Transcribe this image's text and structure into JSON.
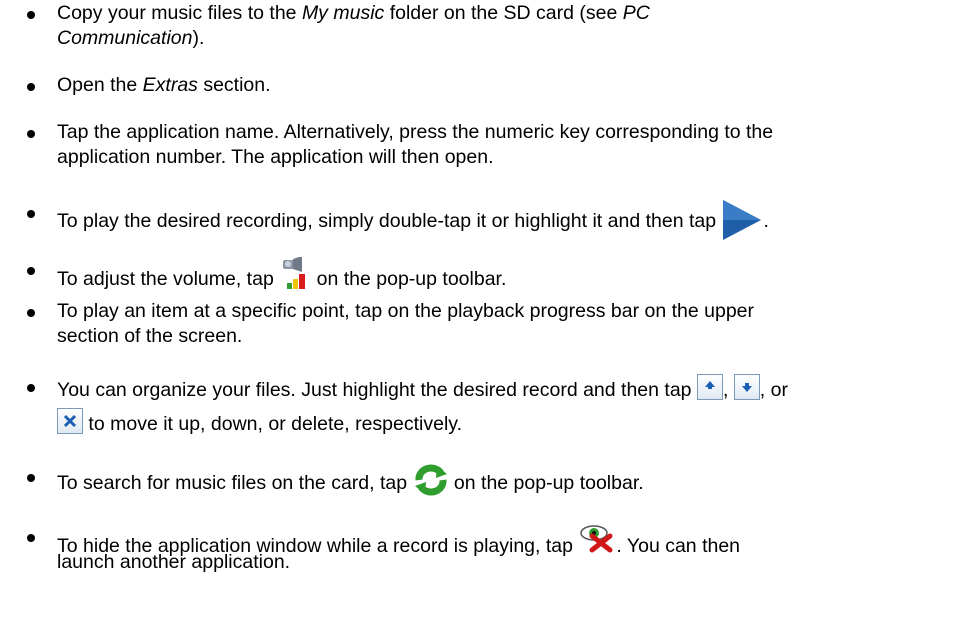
{
  "items": [
    {
      "p1": "Copy your music files to the ",
      "em1": "My music",
      "p2": " folder on the SD card (see ",
      "em2": "PC",
      "line2_em": "Communication",
      "line2_end": ")."
    },
    {
      "p1": "Open the ",
      "em1": "Extras",
      "p2": " section."
    },
    {
      "line1": "Tap the application name. Alternatively, press the numeric key corresponding to the",
      "line2": "application number. The application will then open."
    },
    {
      "p1": "To play the desired recording, simply double-tap it or highlight it and then tap",
      "icon": "play-icon",
      "end": "."
    },
    {
      "p1": "To adjust the volume, tap",
      "icon": "volume-icon",
      "p2": "on the pop-up toolbar."
    },
    {
      "line1": "To play an item at a specific point, tap on the playback progress bar on the upper",
      "line2": "section of the screen."
    },
    {
      "p1": "You can organize your files. Just highlight the desired record and then tap",
      "icons": [
        "move-up-icon",
        "move-down-icon",
        "delete-icon"
      ],
      "sep": ",",
      "or": "or",
      "line2": "to move it up, down, or delete, respectively."
    },
    {
      "p1": "To search for music files on the card, tap",
      "icon": "refresh-icon",
      "p2": "on the pop-up toolbar."
    },
    {
      "p1": "To hide the application window while a record is playing, tap",
      "icon": "hide-window-icon",
      "p2": ". You can then",
      "line2": "launch another application."
    }
  ],
  "colors": {
    "play": "#1f5fa8",
    "refresh": "#2f9e2f",
    "delete": "#1a5fb4",
    "hide_x": "#d01818"
  }
}
